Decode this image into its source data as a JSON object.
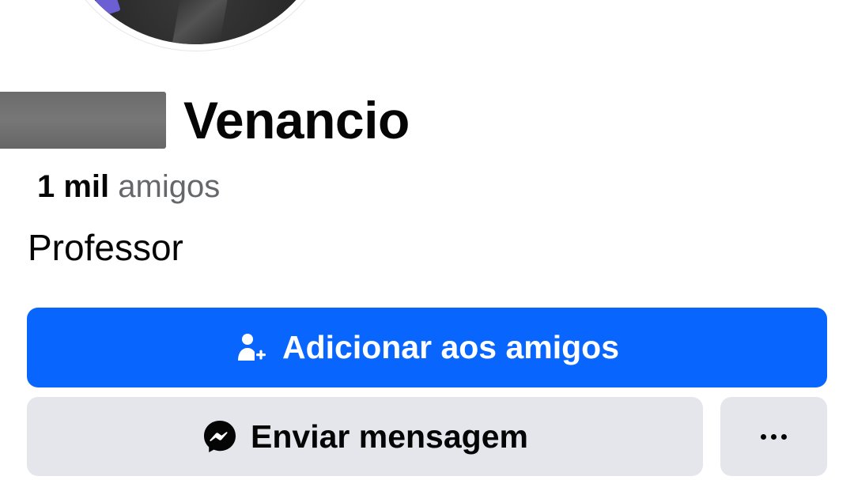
{
  "profile": {
    "name_visible": "Venancio",
    "friends_count": "1 mil",
    "friends_label": "amigos",
    "bio": "Professor"
  },
  "actions": {
    "add_friend_label": "Adicionar aos amigos",
    "message_label": "Enviar mensagem",
    "more_icon": "more-horizontal-icon"
  },
  "colors": {
    "primary": "#0866ff",
    "secondary_bg": "#e4e6eb",
    "text_primary": "#050505",
    "text_secondary": "#65676b"
  }
}
